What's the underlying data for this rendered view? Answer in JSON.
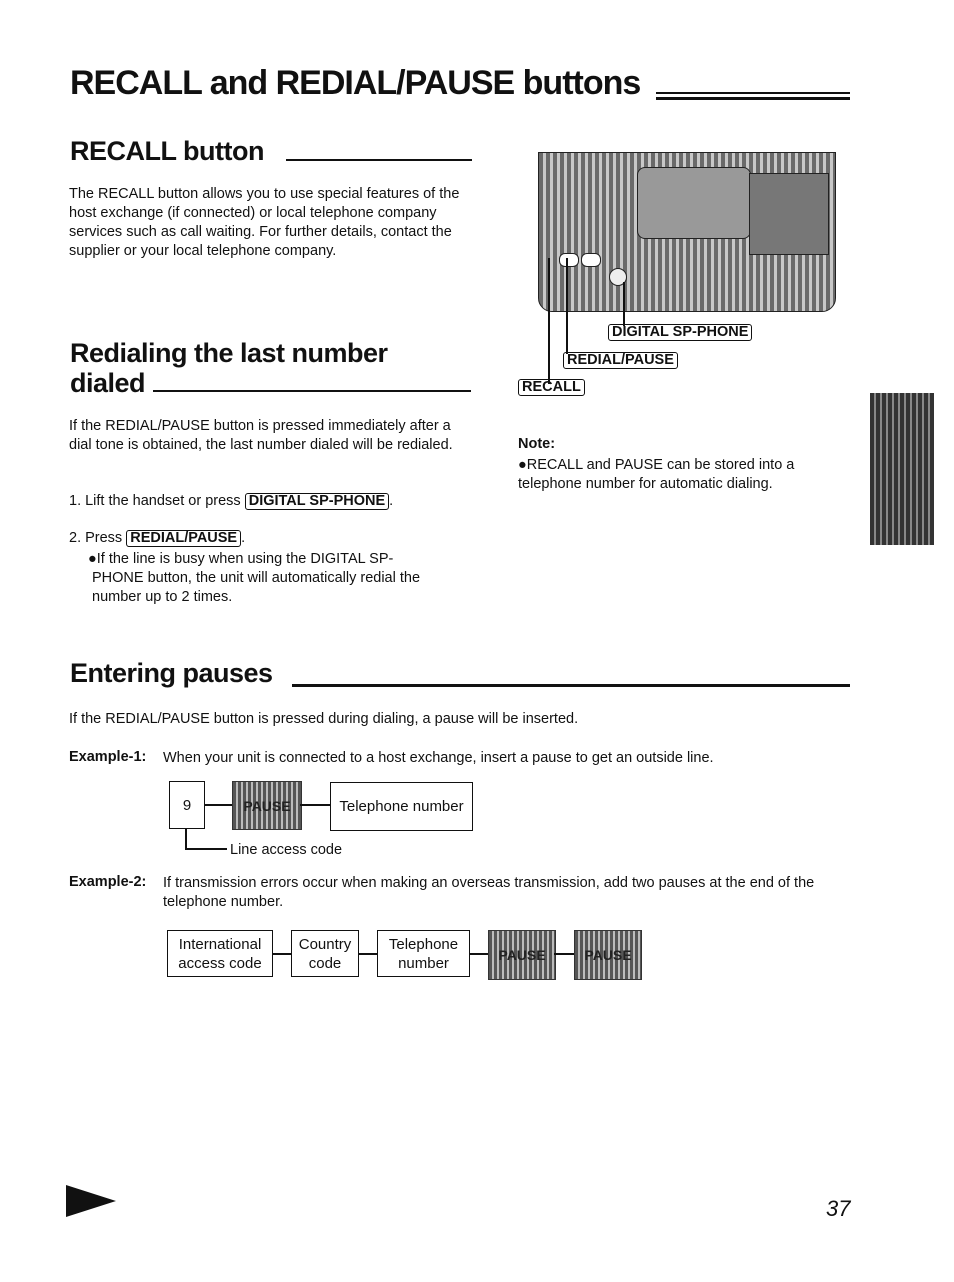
{
  "title": "RECALL and REDIAL/PAUSE buttons",
  "recall": {
    "heading": "RECALL button",
    "body": "The RECALL button allows you to use special features of the host exchange (if connected) or local telephone company services such as call waiting. For further details, contact the supplier or your local telephone company."
  },
  "redial": {
    "heading_line1": "Redialing the last number",
    "heading_line2": "dialed",
    "body": "If the REDIAL/PAUSE button is pressed immediately after a dial tone is obtained, the last number dialed will be redialed.",
    "step1_prefix": "1. Lift the handset or press",
    "step1_key": "DIGITAL SP-PHONE",
    "step2_prefix": "2. Press",
    "step2_key": "REDIAL/PAUSE",
    "bullet": "●If the line is busy when using the DIGITAL SP-PHONE button, the unit will automatically redial the number up to 2 times."
  },
  "figure": {
    "label_digital": "DIGITAL SP-PHONE",
    "label_redial": "REDIAL/PAUSE",
    "label_recall": "RECALL"
  },
  "note": {
    "title": "Note:",
    "text": "●RECALL and PAUSE can be stored into a telephone number for automatic dialing."
  },
  "pauses": {
    "heading": "Entering pauses",
    "intro": "If the REDIAL/PAUSE button is pressed during dialing, a pause will be inserted.",
    "ex1_label": "Example-1:",
    "ex1_text": "When your unit is connected to a host exchange, insert a pause to get an outside line.",
    "ex1_boxes": [
      "9",
      "PAUSE",
      "Telephone number"
    ],
    "ex1_note": "Line access code",
    "ex2_label": "Example-2:",
    "ex2_text": "If transmission errors occur when making an overseas transmission, add two pauses at the end of the telephone number.",
    "ex2_boxes": [
      "International access code",
      "Country code",
      "Telephone number",
      "PAUSE",
      "PAUSE"
    ]
  },
  "page_number": "37"
}
